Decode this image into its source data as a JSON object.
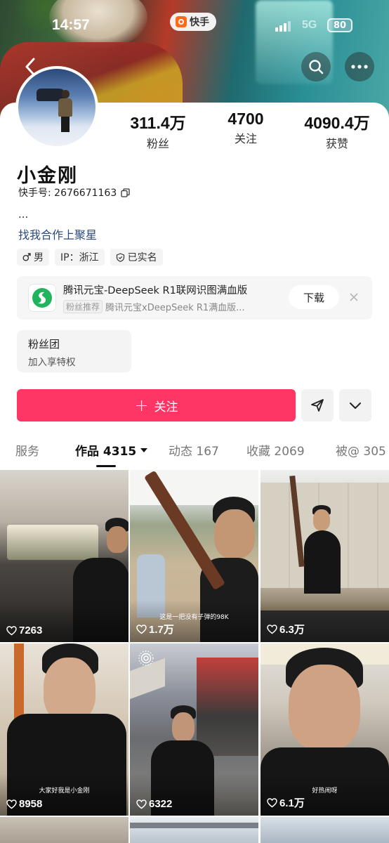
{
  "status_bar": {
    "time": "14:57",
    "app_name": "快手",
    "network": "5G",
    "battery": "80"
  },
  "profile": {
    "name": "小金刚",
    "kwai_id": "快手号: 2676671163",
    "bio_line1": "...",
    "bio_link": "找我合作上聚星",
    "tags": [
      {
        "icon": "male-icon",
        "label": "男"
      },
      {
        "icon": "",
        "label": "IP：浙江"
      },
      {
        "icon": "verified-shield-icon",
        "label": "已实名"
      }
    ]
  },
  "stats": [
    {
      "value": "311.4万",
      "label": "粉丝"
    },
    {
      "value": "4700",
      "label": "关注"
    },
    {
      "value": "4090.4万",
      "label": "获赞"
    }
  ],
  "ad": {
    "title": "腾讯元宝-DeepSeek R1联网识图满血版",
    "badge": "粉丝推荐",
    "subtitle": "腾讯元宝xDeepSeek R1满血版...",
    "download_label": "下载",
    "logo_color": "#22b35e"
  },
  "fans_club": {
    "title": "粉丝团",
    "subtitle": "加入享特权"
  },
  "actions": {
    "follow_label": "关注",
    "follow_color": "#fe3666"
  },
  "tabs": [
    {
      "label": "服务"
    },
    {
      "label": "作品 4315",
      "active": true
    },
    {
      "label": "动态 167"
    },
    {
      "label": "收藏 2069"
    },
    {
      "label": "被@ 305"
    }
  ],
  "videos": [
    {
      "likes": "7263",
      "caption": ""
    },
    {
      "likes": "1.7万",
      "caption": "这是一把没有子弹的98K"
    },
    {
      "likes": "6.3万",
      "caption": ""
    },
    {
      "likes": "8958",
      "caption": "大家好我是小金刚"
    },
    {
      "likes": "6322",
      "caption": ""
    },
    {
      "likes": "6.1万",
      "caption": "好热闹呀"
    }
  ]
}
